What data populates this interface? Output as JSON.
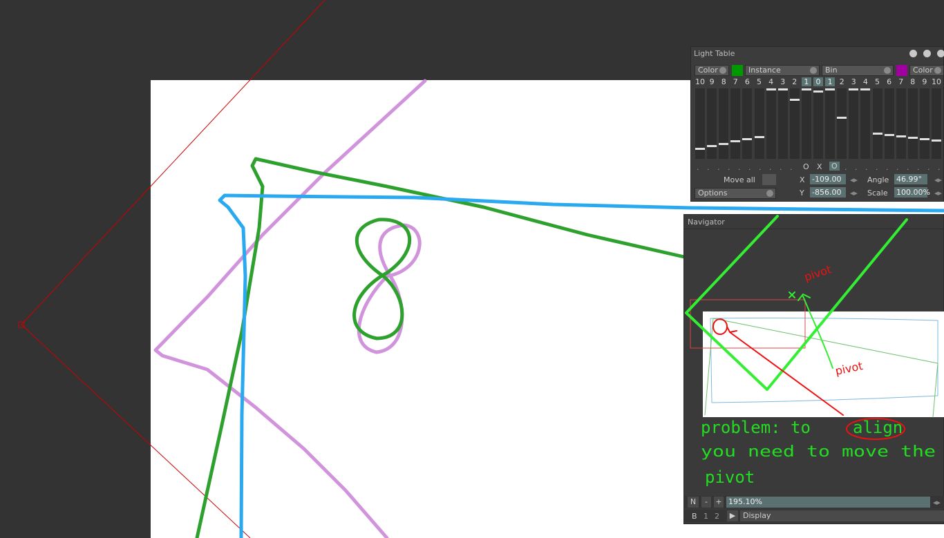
{
  "light_table": {
    "title": "Light Table",
    "left_mode": "Color",
    "left_color": "#009900",
    "instance_label": "Instance",
    "bin_label": "Bin",
    "right_color": "#a000a0",
    "right_mode": "Color",
    "numbers": [
      "10",
      "9",
      "8",
      "7",
      "6",
      "5",
      "4",
      "3",
      "2",
      "1",
      "0",
      "1",
      "2",
      "3",
      "4",
      "5",
      "6",
      "7",
      "8",
      "9",
      "10"
    ],
    "highlighted_numbers": [
      9,
      10,
      11
    ],
    "toggles_left": "O",
    "toggles_mid": "X",
    "toggles_right": "O",
    "move_all_label": "Move all",
    "options_label": "Options",
    "x_label": "X",
    "x_value": "-109.00",
    "y_label": "Y",
    "y_value": "-856.00",
    "angle_label": "Angle",
    "angle_value": "46.99°",
    "scale_label": "Scale",
    "scale_value": "100.00%"
  },
  "navigator": {
    "title": "Navigator",
    "annotation_pivot_1": "pivot",
    "annotation_pivot_2": "pivot",
    "annotation_text_line1": "problem:  to",
    "annotation_highlight": "align",
    "annotation_text_line2": "you need to move the",
    "annotation_text_line3": "pivot",
    "n_label": "N",
    "minus_label": "-",
    "plus_label": "+",
    "zoom_value": "195.10%",
    "b_label": "B",
    "one_label": "1",
    "two_label": "2",
    "display_label": "Display"
  },
  "colors": {
    "background": "#333333",
    "paper": "#ffffff",
    "stroke_green": "#2ea02e",
    "stroke_blue": "#2aa8f0",
    "stroke_purple": "#cc88d8",
    "selection_red": "#cc0000",
    "annotation_green": "#22dd22",
    "annotation_red": "#ee1111"
  }
}
